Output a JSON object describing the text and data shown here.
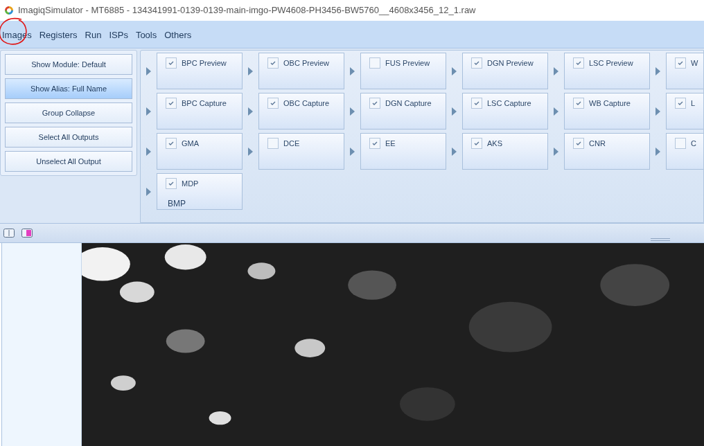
{
  "window": {
    "title": "ImagiqSimulator - MT6885 - 134341991-0139-0139-main-imgo-PW4608-PH3456-BW5760__4608x3456_12_1.raw"
  },
  "menu": [
    {
      "label": "Images",
      "annotated": true
    },
    {
      "label": "Registers",
      "annotated": false
    },
    {
      "label": "Run",
      "annotated": false
    },
    {
      "label": "ISPs",
      "annotated": false
    },
    {
      "label": "Tools",
      "annotated": false
    },
    {
      "label": "Others",
      "annotated": false
    }
  ],
  "side_buttons": [
    {
      "label": "Show Module: Default",
      "selected": false
    },
    {
      "label": "Show Alias: Full Name",
      "selected": true
    },
    {
      "label": "Group Collapse",
      "selected": false
    },
    {
      "label": "Select All Outputs",
      "selected": false
    },
    {
      "label": "Unselect All Output",
      "selected": false
    }
  ],
  "modules": [
    [
      {
        "label": "BPC Preview",
        "checked": true
      },
      {
        "label": "OBC Preview",
        "checked": true
      },
      {
        "label": "FUS Preview",
        "checked": false
      },
      {
        "label": "DGN Preview",
        "checked": true
      },
      {
        "label": "LSC Preview",
        "checked": true
      },
      {
        "label": "W",
        "checked": true
      }
    ],
    [
      {
        "label": "BPC Capture",
        "checked": true
      },
      {
        "label": "OBC Capture",
        "checked": true
      },
      {
        "label": "DGN Capture",
        "checked": true
      },
      {
        "label": "LSC Capture",
        "checked": true
      },
      {
        "label": "WB Capture",
        "checked": true
      },
      {
        "label": "L",
        "checked": true
      }
    ],
    [
      {
        "label": "GMA",
        "checked": true
      },
      {
        "label": "DCE",
        "checked": false
      },
      {
        "label": "EE",
        "checked": true
      },
      {
        "label": "AKS",
        "checked": true
      },
      {
        "label": "CNR",
        "checked": true
      },
      {
        "label": "C",
        "checked": false
      }
    ],
    [
      {
        "label": "MDP",
        "checked": true,
        "sub": "BMP"
      }
    ]
  ]
}
